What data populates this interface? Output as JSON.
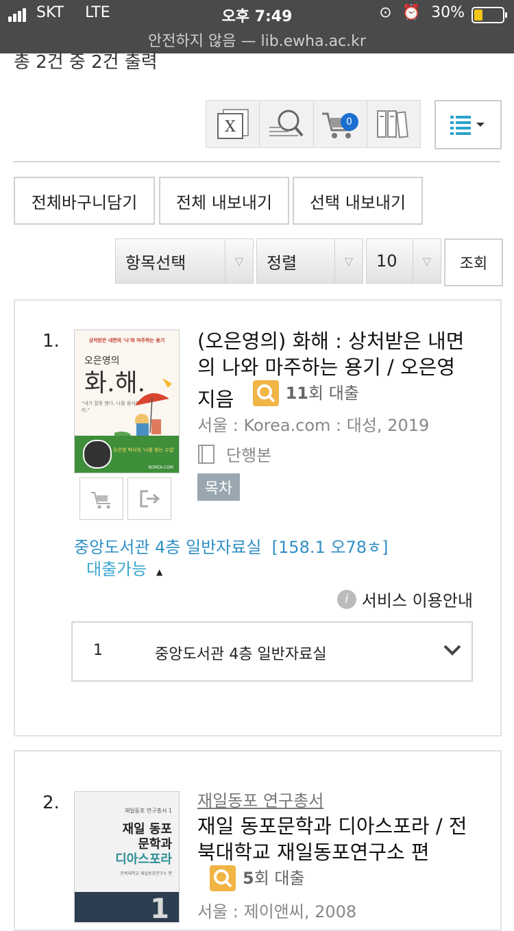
{
  "status_bar": {
    "carrier": "SKT",
    "network": "LTE",
    "time": "오후 7:49",
    "battery": "30%",
    "url": "안전하지 않음 — lib.ewha.ac.kr"
  },
  "summary": {
    "count_text": "총 2건 중 2건 출력"
  },
  "toolbar": {
    "icons": [
      "excel-export-icon",
      "search-icon",
      "cart-icon",
      "bookshelf-icon"
    ],
    "cart_count": "0",
    "view_icon": "list-view-icon"
  },
  "actions": {
    "add_all_cart": "전체바구니담기",
    "export_all": "전체 내보내기",
    "export_selected": "선택 내보내기"
  },
  "filters": {
    "field": "항목선택",
    "sort": "정렬",
    "per_page": "10",
    "search_button": "조회"
  },
  "results": [
    {
      "number": "1.",
      "title": "(오은영의) 화해 : 상처받은 내면의 나와 마주하는 용기 / 오은영 지음",
      "loan_count": "11",
      "loan_unit": "회 대출",
      "publisher": "서울 : Korea.com : 대성, 2019",
      "format": "단행본",
      "toc_label": "목차",
      "cover": {
        "top_text": "상처받은 내면의 '나'와 마주하는 용기",
        "author": "오은영의",
        "title": "화.해.",
        "quote": "\"내가 잘못 했다, 나를 용서하라,\"",
        "bottom_text": "오은영 박사의 '나를 찾는 수업'",
        "publisher": "KOREA.COM"
      },
      "location": "중앙도서관 4층 일반자료실  [158.1 오78ㅎ]",
      "availability": "대출가능",
      "service_guide": "서비스 이용안내",
      "holding": {
        "index": "1",
        "location": "중앙도서관 4층 일반자료실"
      }
    },
    {
      "number": "2.",
      "series": "재일동포 연구총서",
      "title": "재일 동포문학과 디아스포라 / 전북대학교 재일동포연구소 편",
      "loan_count": "5",
      "loan_unit": "회 대출",
      "publisher": "서울 : 제이앤씨, 2008",
      "cover": {
        "series": "재일동포 연구총서 1",
        "title_line1": "재일 동포",
        "title_line2": "문학과",
        "title_line3": "디아스포라",
        "editor": "전북대학교 재일동포연구소 편",
        "volume": "1"
      }
    }
  ]
}
